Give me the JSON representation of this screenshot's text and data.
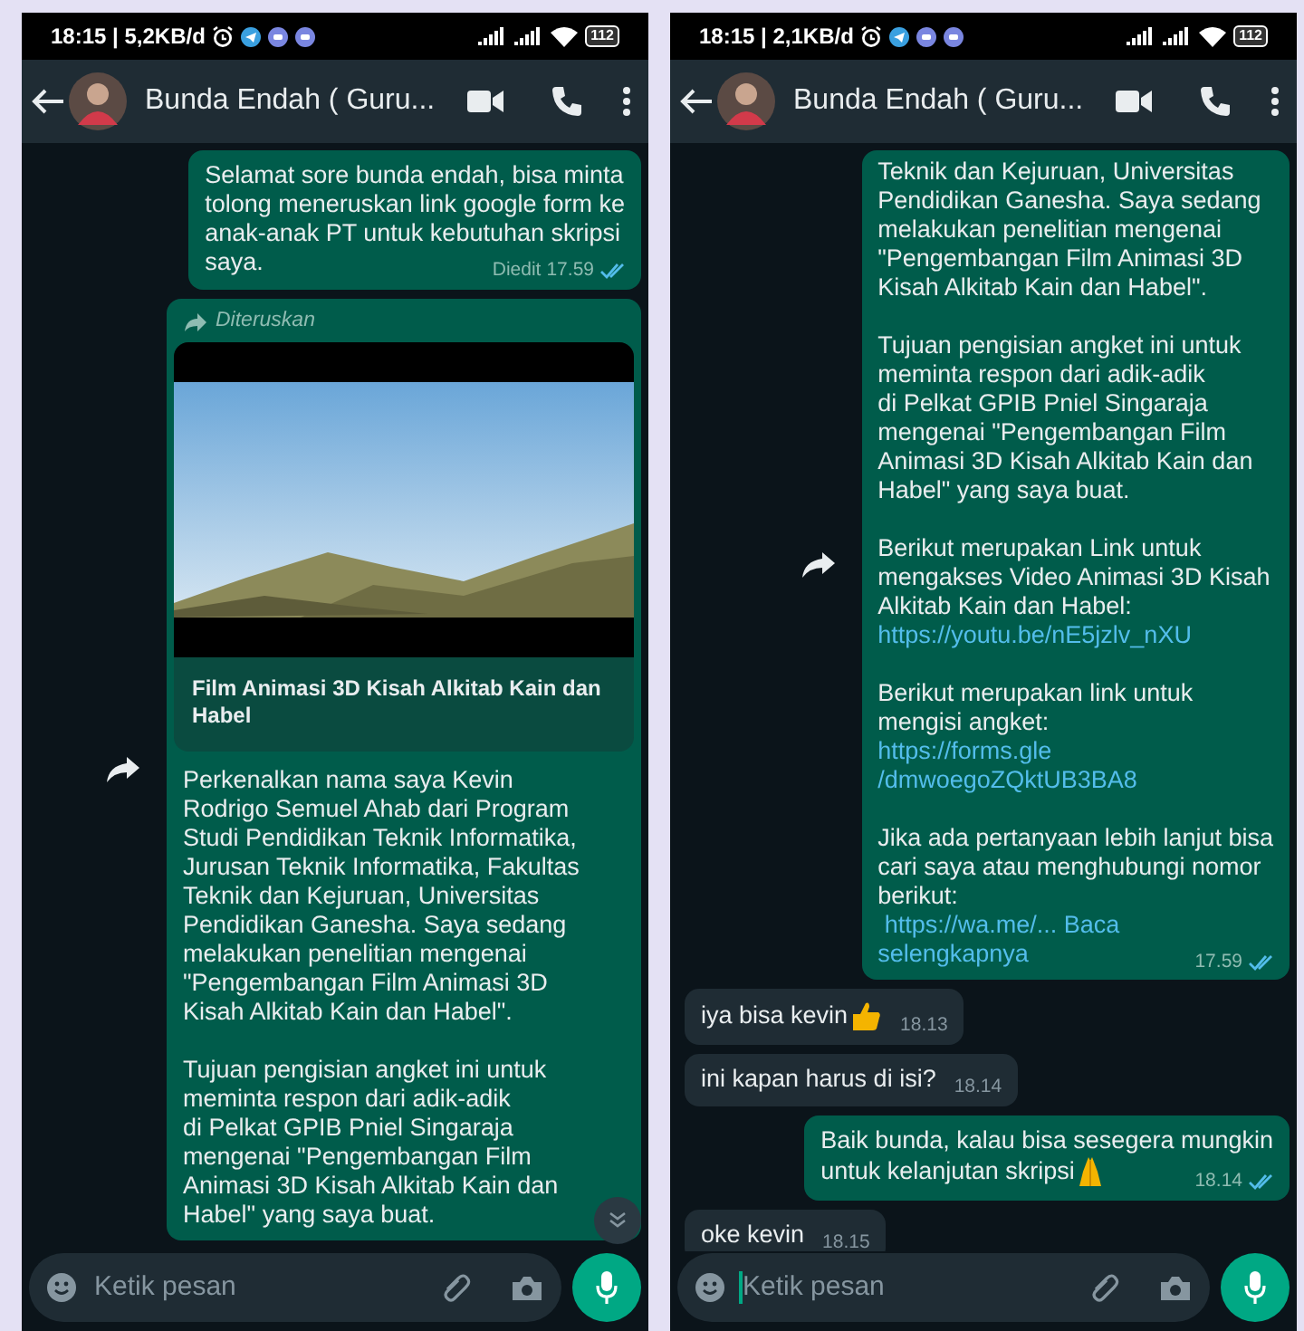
{
  "panels": [
    {
      "status_bar": {
        "time": "18:15 | 5,2KB/d",
        "battery": "112"
      },
      "header": {
        "title": "Bunda Endah ( Guru..."
      },
      "messages": [
        {
          "kind": "outgoing",
          "paragraphs": [
            [
              {
                "text": "Selamat sore bunda endah, bisa minta",
                "link": false
              },
              {
                "text": "tolong meneruskan link google form ke",
                "link": false
              },
              {
                "text": "anak-anak PT untuk kebutuhan skripsi",
                "link": false
              },
              {
                "text": "saya.",
                "link": false
              }
            ]
          ],
          "edited": "Diedit",
          "time": "17.59"
        },
        {
          "kind": "forwarded",
          "forwarded_label": "Diteruskan",
          "preview": {
            "kind": "picture",
            "title": "Film Animasi 3D Kisah Alkitab Kain dan Habel"
          },
          "paragraphs": [
            [
              {
                "text": "Perkenalkan nama saya Kevin",
                "link": false
              },
              {
                "text": "Rodrigo Semuel Ahab dari Program",
                "link": false
              },
              {
                "text": "Studi Pendidikan Teknik Informatika,",
                "link": false
              },
              {
                "text": "Jurusan Teknik Informatika, Fakultas",
                "link": false
              },
              {
                "text": "Teknik dan Kejuruan, Universitas",
                "link": false
              },
              {
                "text": "Pendidikan Ganesha. Saya sedang",
                "link": false
              },
              {
                "text": "melakukan penelitian mengenai",
                "link": false
              },
              {
                "text": "\"Pengembangan Film Animasi 3D",
                "link": false
              },
              {
                "text": "Kisah Alkitab Kain dan Habel\".",
                "link": false
              }
            ],
            [
              {
                "text": "Tujuan pengisian angket ini untuk",
                "link": false
              },
              {
                "text": "meminta respon dari adik-adik",
                "link": false
              },
              {
                "text": "di Pelkat GPIB Pniel Singaraja",
                "link": false
              },
              {
                "text": "mengenai \"Pengembangan Film",
                "link": false
              },
              {
                "text": "Animasi 3D Kisah Alkitab Kain dan",
                "link": false
              },
              {
                "text": "Habel\" yang saya buat.",
                "link": false
              }
            ]
          ]
        }
      ],
      "input": {
        "placeholder": "Ketik pesan",
        "focused": false
      },
      "scroll_down_button": true
    },
    {
      "status_bar": {
        "time": "18:15 | 2,1KB/d",
        "battery": "112"
      },
      "header": {
        "title": "Bunda Endah ( Guru..."
      },
      "messages": [
        {
          "kind": "forwarded",
          "time": "17.59",
          "paragraphs": [
            [
              {
                "text": "Teknik dan Kejuruan, Universitas",
                "link": false
              },
              {
                "text": "Pendidikan Ganesha. Saya sedang",
                "link": false
              },
              {
                "text": "melakukan penelitian mengenai",
                "link": false
              },
              {
                "text": "\"Pengembangan Film Animasi 3D",
                "link": false
              },
              {
                "text": "Kisah Alkitab Kain dan Habel\".",
                "link": false
              }
            ],
            [
              {
                "text": "Tujuan pengisian angket ini untuk",
                "link": false
              },
              {
                "text": "meminta respon dari adik-adik",
                "link": false
              },
              {
                "text": "di Pelkat GPIB Pniel Singaraja",
                "link": false
              },
              {
                "text": "mengenai \"Pengembangan Film",
                "link": false
              },
              {
                "text": "Animasi 3D Kisah Alkitab Kain dan",
                "link": false
              },
              {
                "text": "Habel\" yang saya buat.",
                "link": false
              }
            ],
            [
              {
                "text": "Berikut merupakan Link untuk",
                "link": false
              },
              {
                "text": "mengakses Video Animasi 3D Kisah",
                "link": false
              },
              {
                "text": "Alkitab Kain dan Habel:",
                "link": false
              },
              {
                "text": "https://youtu.be/nE5jzlv_nXU",
                "link": true
              }
            ],
            [
              {
                "text": "Berikut merupakan link untuk",
                "link": false
              },
              {
                "text": "mengisi angket:",
                "link": false
              },
              {
                "text": "https://forms.gle",
                "link": true
              },
              {
                "text": "/dmwoegoZQktUB3BA8",
                "link": true
              }
            ],
            [
              {
                "text": "Jika ada pertanyaan lebih lanjut bisa",
                "link": false
              },
              {
                "text": "cari saya atau menghubungi nomor",
                "link": false
              },
              {
                "text": "berikut:",
                "link": false
              },
              {
                "text": " https://wa.me/... Baca",
                "link": true
              },
              {
                "text": "selengkapnya",
                "link": true
              }
            ]
          ]
        },
        {
          "kind": "incoming",
          "paragraphs": [
            [
              {
                "text": "iya bisa kevin",
                "link": false
              }
            ]
          ],
          "emoji": {
            "kind": "thumbs_up"
          },
          "time": "18.13"
        },
        {
          "kind": "incoming",
          "paragraphs": [
            [
              {
                "text": "ini kapan harus di isi?",
                "link": false
              }
            ]
          ],
          "time": "18.14"
        },
        {
          "kind": "outgoing",
          "paragraphs": [
            [
              {
                "text": "Baik bunda, kalau bisa sesegera mungkin",
                "link": false
              },
              {
                "text": "untuk kelanjutan skripsi",
                "link": false
              }
            ]
          ],
          "emoji": {
            "kind": "pray"
          },
          "time": "18.14"
        },
        {
          "kind": "incoming",
          "paragraphs": [
            [
              {
                "text": "oke kevin",
                "link": false
              }
            ]
          ],
          "time": "18.15"
        }
      ],
      "input": {
        "placeholder": "Ketik pesan",
        "focused": true
      },
      "scroll_down_button": false
    }
  ]
}
